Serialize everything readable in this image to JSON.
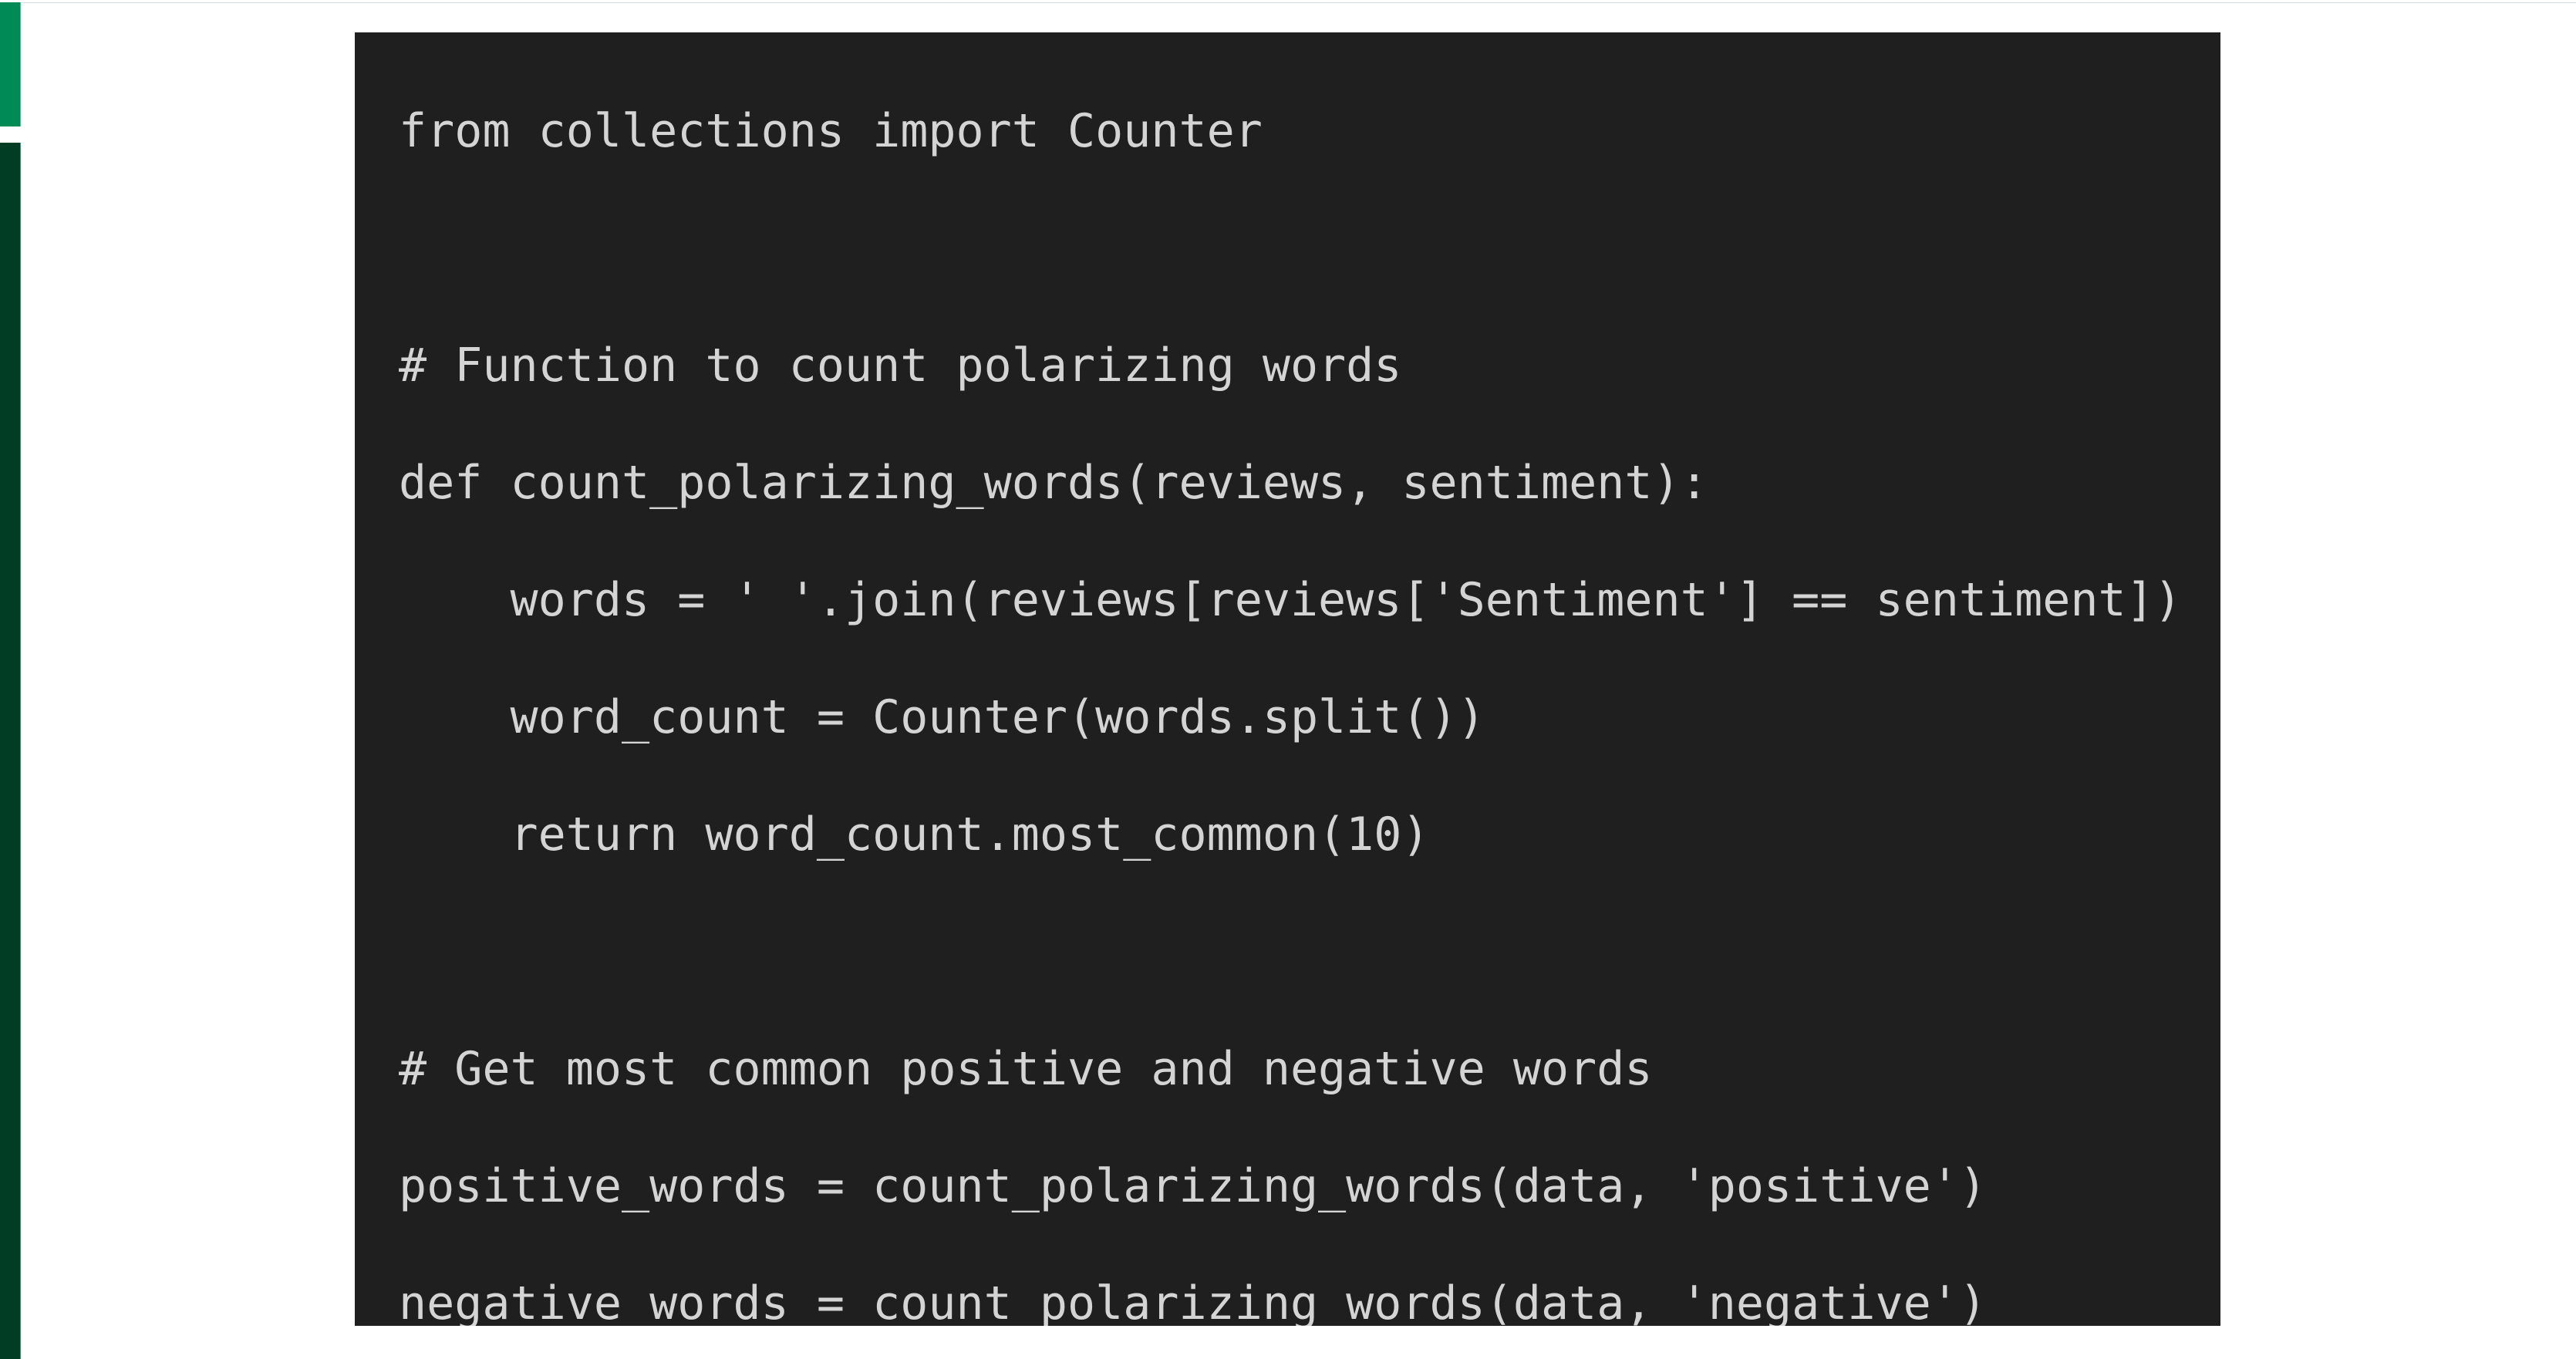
{
  "colors": {
    "accent_light_green": "#008a55",
    "accent_dark_green": "#003d24",
    "code_background": "#1f1f1f",
    "code_text": "#d4d4d4"
  },
  "code_block": {
    "language": "python",
    "lines": [
      "from collections import Counter",
      "",
      "# Function to count polarizing words",
      "def count_polarizing_words(reviews, sentiment):",
      "    words = ' '.join(reviews[reviews['Sentiment'] == sentiment])",
      "    word_count = Counter(words.split())",
      "    return word_count.most_common(10)",
      "",
      "# Get most common positive and negative words",
      "positive_words = count_polarizing_words(data, 'positive')",
      "negative_words = count_polarizing_words(data, 'negative')"
    ]
  }
}
